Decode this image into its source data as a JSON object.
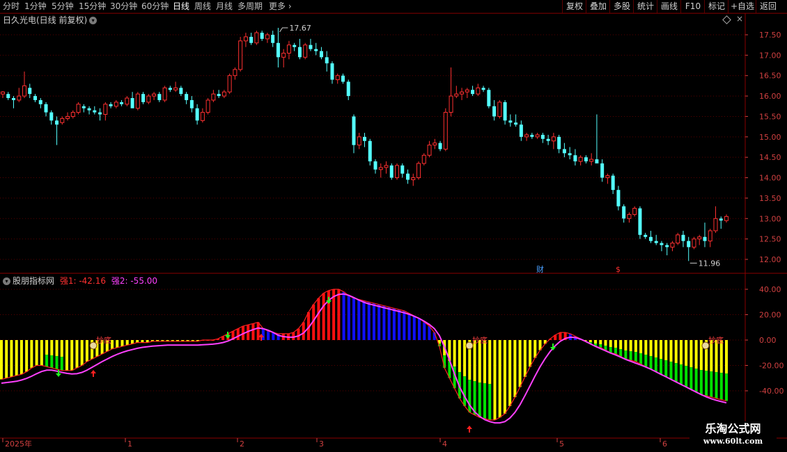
{
  "toolbar": {
    "periods": [
      "分时",
      "1分钟",
      "5分钟",
      "15分钟",
      "30分钟",
      "60分钟",
      "日线",
      "周线",
      "月线",
      "多周期",
      "更多"
    ],
    "active": "日线",
    "right": [
      "复权",
      "叠加",
      "多股",
      "统计",
      "画线",
      "F10",
      "标记",
      "+自选",
      "返回"
    ]
  },
  "main_title": "日久光电(日线 前复权)",
  "indicator": {
    "name": "股朋指标网",
    "s1_label": "强1: -42.16",
    "s2_label": "强2: -55.00"
  },
  "price_axis": [
    "17.50",
    "17.00",
    "16.50",
    "16.00",
    "15.50",
    "15.00",
    "14.50",
    "14.00",
    "13.50",
    "13.00",
    "12.50",
    "12.00"
  ],
  "ind_axis": [
    "40.00",
    "20.00",
    "0.00",
    "-20.00",
    "-40.00"
  ],
  "date_axis": [
    "2025年",
    "1",
    "2",
    "3",
    "4",
    "5",
    "6"
  ],
  "annotations": {
    "high": "17.67",
    "low": "11.96",
    "cai_marker": "财",
    "s_marker": "$",
    "chaodi": "抄底"
  },
  "watermark": {
    "line1": "乐淘公式网",
    "line2": "www.60lt.com"
  },
  "colors": {
    "up": "#ff3030",
    "down": "#54ffff",
    "grid": "#5a0000",
    "yellow": "#ffff00",
    "green": "#00e000",
    "blue": "#1010ff",
    "red": "#ff1010",
    "magenta": "#ff40ff"
  },
  "chart_data": {
    "type": "candlestick",
    "ohlc": [
      [
        16.05,
        16.12,
        15.95,
        16.1
      ],
      [
        16.05,
        16.1,
        15.9,
        15.95
      ],
      [
        15.95,
        16.0,
        15.7,
        15.9
      ],
      [
        15.9,
        16.2,
        15.85,
        16.0
      ],
      [
        16.0,
        16.6,
        15.95,
        16.25
      ],
      [
        16.2,
        16.3,
        15.95,
        16.05
      ],
      [
        16.0,
        16.05,
        15.85,
        15.9
      ],
      [
        15.9,
        15.95,
        15.7,
        15.8
      ],
      [
        15.8,
        15.85,
        15.5,
        15.6
      ],
      [
        15.6,
        15.65,
        15.3,
        15.4
      ],
      [
        15.4,
        15.5,
        14.8,
        15.3
      ],
      [
        15.35,
        15.5,
        15.3,
        15.45
      ],
      [
        15.45,
        15.6,
        15.4,
        15.5
      ],
      [
        15.5,
        15.65,
        15.45,
        15.6
      ],
      [
        15.6,
        15.85,
        15.55,
        15.8
      ],
      [
        15.75,
        15.8,
        15.6,
        15.7
      ],
      [
        15.7,
        15.75,
        15.55,
        15.65
      ],
      [
        15.65,
        15.75,
        15.55,
        15.6
      ],
      [
        15.6,
        15.7,
        15.4,
        15.55
      ],
      [
        15.55,
        15.85,
        15.4,
        15.8
      ],
      [
        15.8,
        15.85,
        15.7,
        15.75
      ],
      [
        15.75,
        15.9,
        15.7,
        15.85
      ],
      [
        15.85,
        15.9,
        15.75,
        15.8
      ],
      [
        15.8,
        16.0,
        15.75,
        15.95
      ],
      [
        15.95,
        16.1,
        15.8,
        15.7
      ],
      [
        15.7,
        16.1,
        15.65,
        16.05
      ],
      [
        16.05,
        16.1,
        15.8,
        15.85
      ],
      [
        15.85,
        16.05,
        15.8,
        16.0
      ],
      [
        16.0,
        16.1,
        15.9,
        16.05
      ],
      [
        16.05,
        16.1,
        15.85,
        15.9
      ],
      [
        15.9,
        16.25,
        15.85,
        16.2
      ],
      [
        16.2,
        16.25,
        16.1,
        16.15
      ],
      [
        16.15,
        16.35,
        16.1,
        16.2
      ],
      [
        16.2,
        16.25,
        16.0,
        16.05
      ],
      [
        16.05,
        16.1,
        15.8,
        15.9
      ],
      [
        15.9,
        16.0,
        15.6,
        15.7
      ],
      [
        15.7,
        15.8,
        15.3,
        15.4
      ],
      [
        15.4,
        15.7,
        15.35,
        15.6
      ],
      [
        15.6,
        15.95,
        15.55,
        15.9
      ],
      [
        15.9,
        16.15,
        15.85,
        16.05
      ],
      [
        16.05,
        16.15,
        15.95,
        16.0
      ],
      [
        16.0,
        16.15,
        15.95,
        16.1
      ],
      [
        16.1,
        16.55,
        16.05,
        16.5
      ],
      [
        16.5,
        16.7,
        16.4,
        16.65
      ],
      [
        16.65,
        17.45,
        16.6,
        17.35
      ],
      [
        17.35,
        17.55,
        17.2,
        17.45
      ],
      [
        17.45,
        17.55,
        17.25,
        17.3
      ],
      [
        17.3,
        17.6,
        17.25,
        17.55
      ],
      [
        17.55,
        17.6,
        17.35,
        17.4
      ],
      [
        17.4,
        17.55,
        17.3,
        17.5
      ],
      [
        17.5,
        17.6,
        17.2,
        17.3
      ],
      [
        17.3,
        17.67,
        16.7,
        16.95
      ],
      [
        16.95,
        17.15,
        16.7,
        17.05
      ],
      [
        17.05,
        17.35,
        16.9,
        17.25
      ],
      [
        17.25,
        17.3,
        17.1,
        17.2
      ],
      [
        17.2,
        17.4,
        16.9,
        16.95
      ],
      [
        16.95,
        17.3,
        16.9,
        17.25
      ],
      [
        17.25,
        17.4,
        17.1,
        17.15
      ],
      [
        17.15,
        17.3,
        17.0,
        17.1
      ],
      [
        17.1,
        17.2,
        16.9,
        16.95
      ],
      [
        16.95,
        17.1,
        16.6,
        16.8
      ],
      [
        16.8,
        16.85,
        16.3,
        16.4
      ],
      [
        16.4,
        16.55,
        16.3,
        16.5
      ],
      [
        16.5,
        16.55,
        16.3,
        16.35
      ],
      [
        16.35,
        16.4,
        15.9,
        16.0
      ],
      [
        15.5,
        15.55,
        14.6,
        14.8
      ],
      [
        14.8,
        15.1,
        14.7,
        15.0
      ],
      [
        15.0,
        15.1,
        14.75,
        14.9
      ],
      [
        14.9,
        14.95,
        14.3,
        14.4
      ],
      [
        14.4,
        14.45,
        14.1,
        14.2
      ],
      [
        14.2,
        14.35,
        14.0,
        14.25
      ],
      [
        14.25,
        14.4,
        14.1,
        14.3
      ],
      [
        14.3,
        14.35,
        13.95,
        14.0
      ],
      [
        14.0,
        14.35,
        13.95,
        14.3
      ],
      [
        14.3,
        14.35,
        14.0,
        14.1
      ],
      [
        14.1,
        14.2,
        13.85,
        13.95
      ],
      [
        13.95,
        14.1,
        13.8,
        14.0
      ],
      [
        14.0,
        14.4,
        13.95,
        14.35
      ],
      [
        14.35,
        14.6,
        14.3,
        14.55
      ],
      [
        14.55,
        14.9,
        14.5,
        14.8
      ],
      [
        14.8,
        14.95,
        14.7,
        14.85
      ],
      [
        14.85,
        14.9,
        14.65,
        14.7
      ],
      [
        14.7,
        15.7,
        14.65,
        15.6
      ],
      [
        15.6,
        16.7,
        15.5,
        16.0
      ],
      [
        16.0,
        16.25,
        15.95,
        16.05
      ],
      [
        16.05,
        16.2,
        15.9,
        16.1
      ],
      [
        16.1,
        16.2,
        15.95,
        16.15
      ],
      [
        16.15,
        16.25,
        16.0,
        16.05
      ],
      [
        16.05,
        16.3,
        16.0,
        16.2
      ],
      [
        16.2,
        16.25,
        16.1,
        16.15
      ],
      [
        16.15,
        16.2,
        15.7,
        15.75
      ],
      [
        15.75,
        15.9,
        15.4,
        15.5
      ],
      [
        15.5,
        15.9,
        15.45,
        15.85
      ],
      [
        15.85,
        15.9,
        15.3,
        15.4
      ],
      [
        15.4,
        15.55,
        15.25,
        15.35
      ],
      [
        15.35,
        15.55,
        15.25,
        15.3
      ],
      [
        15.3,
        15.4,
        14.9,
        15.0
      ],
      [
        15.0,
        15.1,
        14.9,
        15.05
      ],
      [
        15.05,
        15.1,
        14.95,
        15.0
      ],
      [
        15.0,
        15.1,
        14.95,
        15.05
      ],
      [
        15.05,
        15.1,
        14.85,
        14.95
      ],
      [
        14.95,
        15.05,
        14.8,
        14.9
      ],
      [
        14.9,
        15.1,
        14.7,
        15.0
      ],
      [
        15.0,
        15.05,
        14.6,
        14.7
      ],
      [
        14.7,
        14.85,
        14.5,
        14.6
      ],
      [
        14.6,
        14.75,
        14.45,
        14.55
      ],
      [
        14.55,
        14.7,
        14.3,
        14.4
      ],
      [
        14.4,
        14.55,
        14.3,
        14.5
      ],
      [
        14.5,
        14.55,
        14.35,
        14.4
      ],
      [
        14.4,
        14.6,
        14.3,
        14.45
      ],
      [
        14.45,
        15.55,
        14.4,
        14.35
      ],
      [
        14.35,
        14.45,
        13.9,
        14.0
      ],
      [
        14.0,
        14.1,
        13.85,
        14.05
      ],
      [
        14.05,
        14.1,
        13.6,
        13.7
      ],
      [
        13.7,
        13.8,
        13.2,
        13.3
      ],
      [
        13.3,
        13.35,
        12.9,
        13.0
      ],
      [
        13.0,
        13.15,
        12.9,
        13.1
      ],
      [
        13.1,
        13.3,
        13.05,
        13.25
      ],
      [
        13.25,
        13.3,
        12.5,
        12.6
      ],
      [
        12.6,
        12.65,
        12.5,
        12.55
      ],
      [
        12.55,
        12.7,
        12.4,
        12.45
      ],
      [
        12.45,
        12.6,
        12.35,
        12.4
      ],
      [
        12.4,
        12.45,
        12.2,
        12.35
      ],
      [
        12.35,
        12.4,
        12.1,
        12.3
      ],
      [
        12.3,
        12.45,
        12.2,
        12.4
      ],
      [
        12.4,
        12.65,
        12.35,
        12.6
      ],
      [
        12.6,
        12.7,
        12.3,
        12.45
      ],
      [
        12.45,
        12.55,
        11.96,
        12.3
      ],
      [
        12.3,
        12.55,
        12.25,
        12.5
      ],
      [
        12.5,
        12.6,
        12.35,
        12.55
      ],
      [
        12.55,
        12.9,
        12.3,
        12.45
      ],
      [
        12.45,
        12.75,
        12.3,
        12.7
      ],
      [
        12.7,
        13.3,
        12.65,
        13.0
      ],
      [
        13.0,
        13.05,
        12.75,
        12.95
      ],
      [
        12.95,
        13.1,
        12.9,
        13.05
      ]
    ],
    "indicator_bars": [
      -31,
      -30,
      -29,
      -28,
      -27,
      -25,
      -22,
      -20,
      -20,
      -21,
      -22,
      -23,
      -24,
      -24,
      -24,
      -22,
      -20,
      -17,
      -15,
      -13,
      -11,
      -9,
      -7,
      -6,
      -5,
      -4,
      -3,
      -2,
      -2,
      -2,
      -1,
      -1,
      -1,
      -1,
      -1,
      -1,
      -1,
      -1,
      -1,
      -1,
      0,
      0,
      0,
      1,
      3,
      5,
      7,
      9,
      11,
      12,
      13,
      14,
      9,
      7,
      6,
      5,
      5,
      5,
      6,
      9,
      14,
      22,
      28,
      33,
      37,
      39,
      40,
      40,
      38,
      35,
      33,
      32,
      31,
      30,
      29,
      28,
      27,
      26,
      25,
      24,
      23,
      21,
      19,
      17,
      14,
      11,
      6,
      -5,
      -22,
      -30,
      -38,
      -46,
      -52,
      -57,
      -59,
      -61,
      -62,
      -63,
      -63,
      -61,
      -58,
      -52,
      -45,
      -37,
      -29,
      -21,
      -14,
      -8,
      -3,
      1,
      4,
      6,
      6,
      5,
      3,
      1,
      -1,
      -3,
      -5,
      -6,
      -8,
      -10,
      -11,
      -13,
      -15,
      -16,
      -17,
      -19,
      -21,
      -23,
      -25,
      -27,
      -29,
      -31,
      -33,
      -35,
      -37,
      -39,
      -41,
      -43,
      -44,
      -45,
      -46,
      -47,
      -48
    ]
  }
}
